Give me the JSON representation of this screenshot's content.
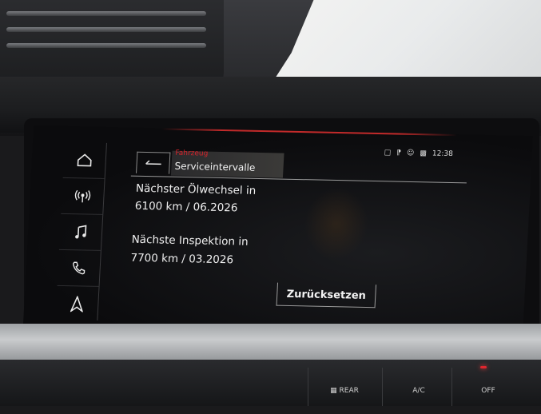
{
  "screen": {
    "breadcrumb": "Fahrzeug",
    "title": "Serviceintervalle",
    "status": {
      "time": "12:38"
    },
    "sidebar": {
      "items": [
        {
          "icon": "home-icon"
        },
        {
          "icon": "radio-icon"
        },
        {
          "icon": "music-icon"
        },
        {
          "icon": "phone-icon"
        },
        {
          "icon": "navigation-icon"
        }
      ]
    },
    "oil_change": {
      "label": "Nächster Ölwechsel in",
      "value": "6100 km / 06.2026"
    },
    "inspection": {
      "label": "Nächste Inspektion in",
      "value": "7700 km / 03.2026"
    },
    "reset_label": "Zurücksetzen"
  },
  "climate_panel": {
    "rear_label": "REAR",
    "ac_label": "A/C",
    "off_label": "OFF"
  },
  "colors": {
    "accent_red": "#d4242b",
    "screen_text": "#f0f0f0"
  }
}
